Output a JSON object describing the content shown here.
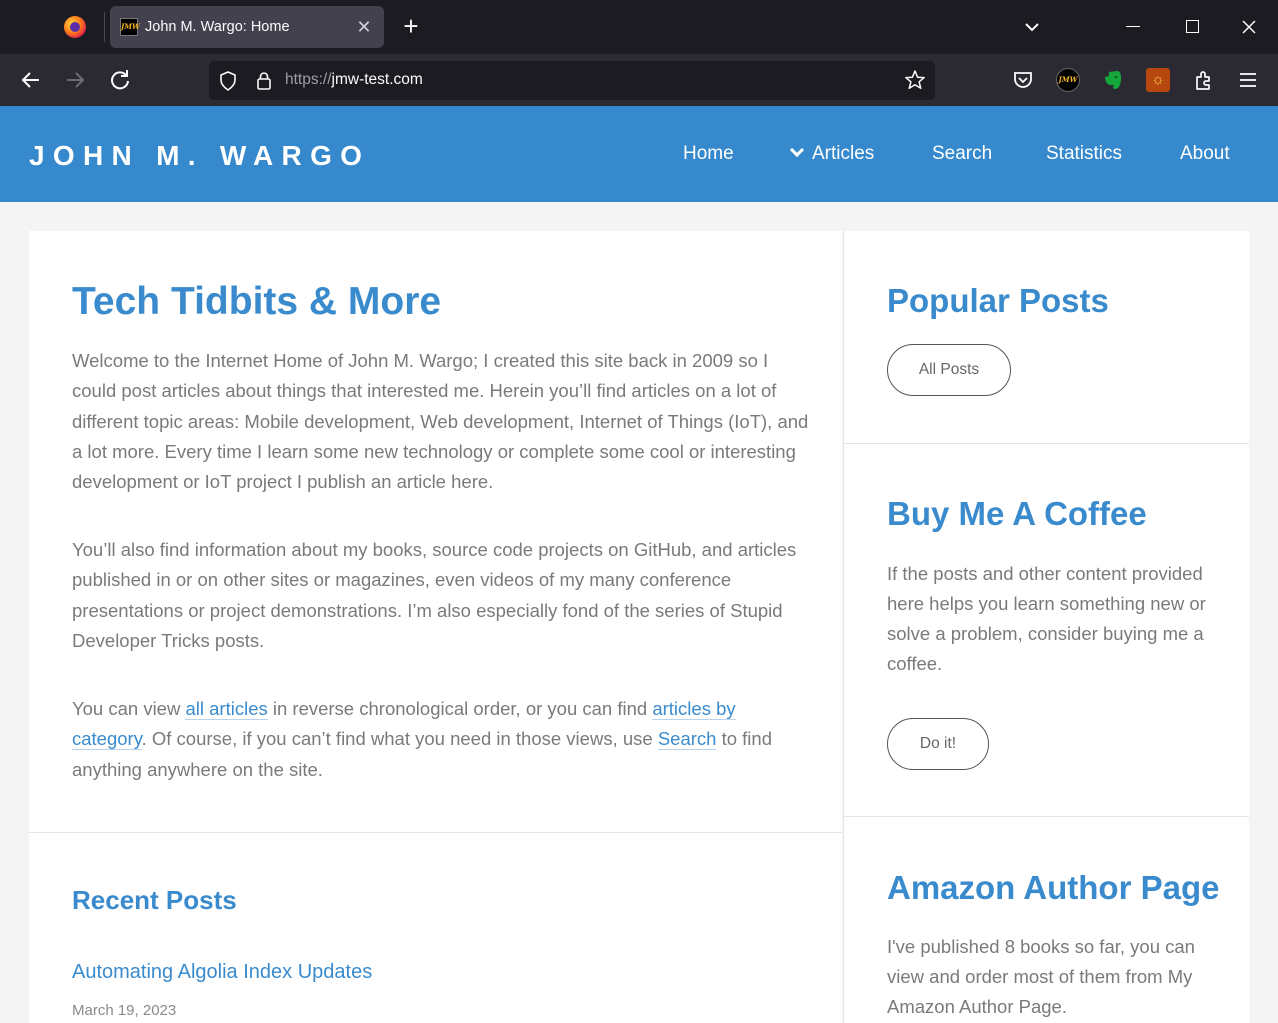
{
  "browser": {
    "tab_title": "John M. Wargo: Home",
    "tab_favicon_text": "JMW",
    "tab_close_glyph": "✕",
    "new_tab_glyph": "+",
    "url_scheme": "https://",
    "url_host": "jmw-test.com",
    "extension_avatar_text": "JMW",
    "icons": [
      "firefox-icon",
      "back-icon",
      "forward-icon",
      "reload-icon",
      "shield-icon",
      "lock-icon",
      "star-icon",
      "pocket-icon",
      "evernote-icon",
      "sun-extension-icon",
      "extensions-icon",
      "menu-icon",
      "tab-list-icon",
      "minimize-icon",
      "maximize-icon",
      "close-icon"
    ]
  },
  "site": {
    "brand": "JOHN M. WARGO",
    "colors": {
      "header": "#3589cc",
      "link": "#3a8bcd",
      "text": "#7a7a7a"
    },
    "nav": {
      "home": "Home",
      "articles": "Articles",
      "search": "Search",
      "statistics": "Statistics",
      "about": "About"
    }
  },
  "main": {
    "heading": "Tech Tidbits & More",
    "para1": "Welcome to the Internet Home of John M. Wargo; I created this site back in 2009 so I could post articles about things that interested me. Herein you’ll find articles on a lot of different topic areas: Mobile development, Web development, Internet of Things (IoT), and a lot more. Every time I learn some new technology or complete some cool or interesting development or IoT project I publish an article here.",
    "para2": "You’ll also find information about my books, source code projects on GitHub, and articles published in or on other sites or magazines, even videos of my many conference presentations or project demonstrations. I’m also especially fond of the series of Stupid Developer Tricks posts.",
    "para3": {
      "t1": "You can view ",
      "link_all": "all articles",
      "t2": " in reverse chronological order, or you can find ",
      "link_category": "articles by category",
      "t3": ". Of course, if you can’t find what you need in those views, use ",
      "link_search": "Search",
      "t4": " to find anything anywhere on the site."
    },
    "recent_heading": "Recent Posts",
    "recent_posts": [
      {
        "title": "Automating Algolia Index Updates",
        "date": "March 19, 2023"
      }
    ]
  },
  "sidebar": {
    "popular_heading": "Popular Posts",
    "all_posts_button": "All Posts",
    "coffee_heading": "Buy Me A Coffee",
    "coffee_text": "If the posts and other content provided here helps you learn something new or solve a problem, consider buying me a coffee.",
    "coffee_button": "Do it!",
    "amazon_heading": "Amazon Author Page",
    "amazon_text": "I've published 8 books so far, you can view and order most of them from My Amazon Author Page."
  }
}
